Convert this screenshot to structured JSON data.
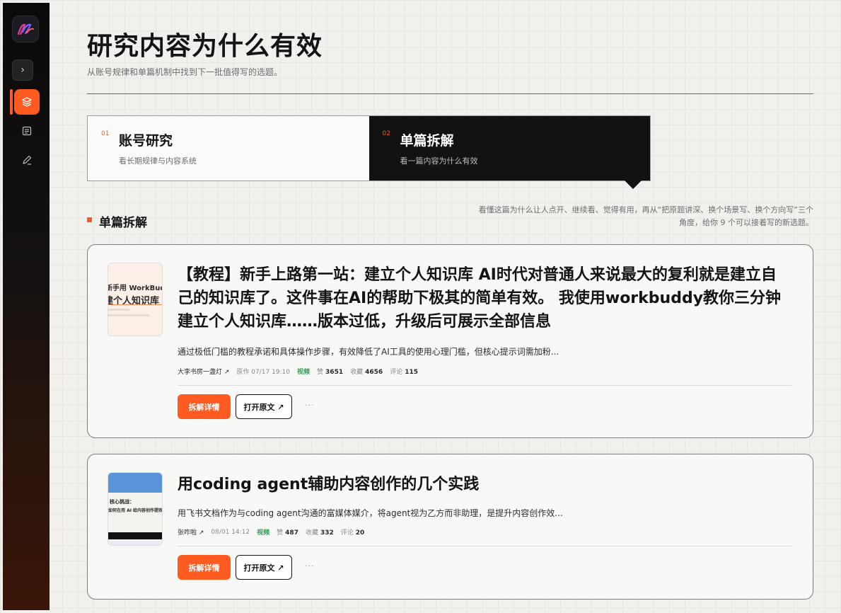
{
  "header": {
    "title": "研究内容为什么有效",
    "subtitle": "从账号规律和单篇机制中找到下一批值得写的选题。"
  },
  "tabs": [
    {
      "num": "01",
      "title": "账号研究",
      "desc": "看长期规律与内容系统"
    },
    {
      "num": "02",
      "title": "单篇拆解",
      "desc": "看一篇内容为什么有效"
    }
  ],
  "section": {
    "title": "单篇拆解",
    "desc": "看懂这篇为什么让人点开、继续看、觉得有用，再从“把原题讲深、换个场景写、换个方向写”三个角度，给你 9 个可以接着写的新选题。"
  },
  "cards": [
    {
      "title": "【教程】新手上路第一站：建立个人知识库 AI时代对普通人来说最大的复利就是建立自己的知识库了。这件事在AI的帮助下极其的简单有效。 我使用workbuddy教你三分钟建立个人知识库……版本过低，升级后可展示全部信息",
      "summary": "通过极低门槛的教程承诺和具体操作步骤，有效降低了AI工具的使用心理门槛，但核心提示词需加粉...",
      "author": "大李书房一盏灯 ↗",
      "date": "原作 07/17 19:10",
      "tag": "视频",
      "likes_label": "赞",
      "likes": "3651",
      "collect_label": "收藏",
      "collect": "4656",
      "comment_label": "评论",
      "comment": "115",
      "thumb_line1": "新手用 WorkBuddy",
      "thumb_line2": "建个人知识库",
      "primary_btn": "拆解详情",
      "secondary_btn": "打开原文 ↗",
      "more": "···"
    },
    {
      "title": "用coding agent辅助内容创作的几个实践",
      "summary": "用飞书文档作为与coding agent沟通的富媒体媒介，将agent视为乙方而非助理，是提升内容创作效...",
      "author": "张咋啦 ↗",
      "date": "08/01 14:12",
      "tag": "视频",
      "likes_label": "赞",
      "likes": "487",
      "collect_label": "收藏",
      "collect": "332",
      "comment_label": "评论",
      "comment": "20",
      "thumb_line1": "核心挑战：",
      "thumb_line2": "如何在用 AI 给内容创作提效",
      "primary_btn": "拆解详情",
      "secondary_btn": "打开原文 ↗",
      "more": "···"
    }
  ],
  "colors": {
    "accent": "#ff5a1f",
    "dark": "#121212",
    "background": "#f1f0ec",
    "tag_green": "#2f9e56"
  },
  "icons": {
    "logo": "app-logo",
    "expand": "chevron-right-icon",
    "nav": [
      "layers-icon",
      "document-icon",
      "pen-icon"
    ]
  }
}
